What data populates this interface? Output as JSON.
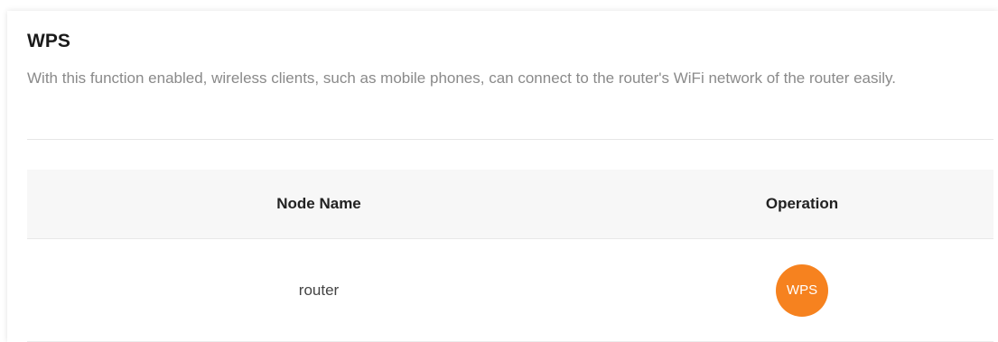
{
  "section": {
    "title": "WPS",
    "description": "With this function enabled, wireless clients, such as mobile phones, can connect to the router's WiFi network of the router easily."
  },
  "table": {
    "headers": {
      "node_name": "Node Name",
      "operation": "Operation"
    },
    "rows": [
      {
        "node_name": "router",
        "operation_label": "WPS"
      }
    ]
  },
  "colors": {
    "accent": "#f6821f",
    "header_bg": "#f7f7f7",
    "description_text": "#8a8a8a"
  }
}
